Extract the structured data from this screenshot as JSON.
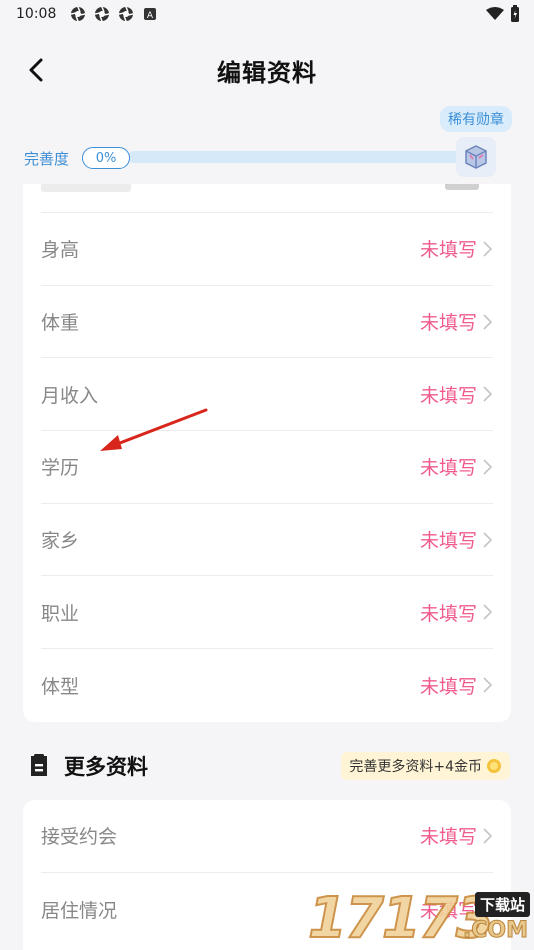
{
  "status_bar": {
    "time": "10:08",
    "left_icons": [
      "aperture-icon",
      "aperture-icon",
      "aperture-icon",
      "a-badge-icon"
    ],
    "right_icons": [
      "wifi-icon",
      "battery-icon"
    ]
  },
  "header": {
    "title": "编辑资料",
    "back_icon": "back-chevron-icon"
  },
  "progress": {
    "label": "完善度",
    "percent_text": "0%",
    "percent_value": 0,
    "badge_label": "稀有勋章",
    "medal_icon": "medal-icon",
    "accent_color": "#3d8fd6"
  },
  "basic_info": {
    "rows": [
      {
        "label": "身高",
        "value": "未填写"
      },
      {
        "label": "体重",
        "value": "未填写"
      },
      {
        "label": "月收入",
        "value": "未填写"
      },
      {
        "label": "学历",
        "value": "未填写"
      },
      {
        "label": "家乡",
        "value": "未填写"
      },
      {
        "label": "职业",
        "value": "未填写"
      },
      {
        "label": "体型",
        "value": "未填写"
      }
    ],
    "value_color": "#f05a8e"
  },
  "more_section": {
    "title": "更多资料",
    "icon": "document-icon",
    "reward_text": "完善更多资料+4金币",
    "reward_icon": "coin-icon",
    "rows": [
      {
        "label": "接受约会",
        "value": "未填写"
      },
      {
        "label": "居住情况",
        "value": "未填写"
      }
    ]
  },
  "watermark": {
    "digits": "17173",
    "site": "下载站",
    "domain": ".COM"
  }
}
